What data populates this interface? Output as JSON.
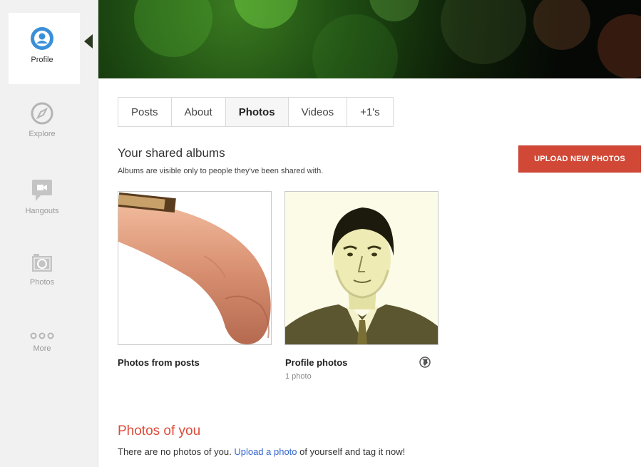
{
  "sidebar": {
    "items": [
      {
        "label": "Profile",
        "icon": "profile-icon",
        "active": true
      },
      {
        "label": "Explore",
        "icon": "compass-icon"
      },
      {
        "label": "Hangouts",
        "icon": "video-camera-icon"
      },
      {
        "label": "Photos",
        "icon": "camera-icon"
      },
      {
        "label": "More",
        "icon": "more-dots-icon"
      }
    ]
  },
  "tabs": [
    {
      "label": "Posts"
    },
    {
      "label": "About"
    },
    {
      "label": "Photos",
      "active": true
    },
    {
      "label": "Videos"
    },
    {
      "label": "+1's"
    }
  ],
  "albums_section": {
    "title": "Your shared albums",
    "subtitle": "Albums are visible only to people they've been shared with.",
    "upload_button": "UPLOAD NEW PHOTOS"
  },
  "albums": [
    {
      "name": "Photos from posts",
      "count": ""
    },
    {
      "name": "Profile photos",
      "count": "1 photo",
      "visibility_icon": "globe-icon"
    }
  ],
  "photos_of_you": {
    "title": "Photos of you",
    "text_before": "There are no photos of you. ",
    "link": "Upload a photo",
    "text_after": " of yourself and tag it now!"
  },
  "colors": {
    "accent_red": "#d14836",
    "title_red": "#dd4b39",
    "link_blue": "#3366cc",
    "sidebar_bg": "#f1f1f1"
  }
}
